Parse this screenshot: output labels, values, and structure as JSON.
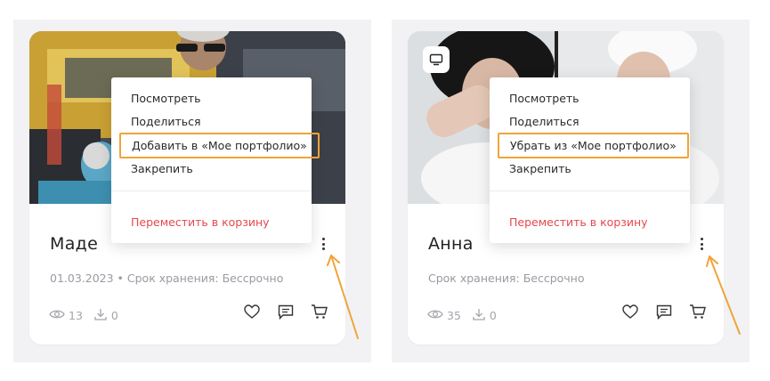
{
  "accent_color": "#f0a43a",
  "danger_color": "#e5484d",
  "cards": [
    {
      "title": "Маде",
      "meta": "01.03.2023 • Срок хранения: Бессрочно",
      "views": "13",
      "downloads": "0",
      "has_video_badge": false
    },
    {
      "title": "Анна",
      "meta": "Срок хранения: Бессрочно",
      "views": "35",
      "downloads": "0",
      "has_video_badge": true
    }
  ],
  "menus": [
    {
      "items": [
        "Посмотреть",
        "Поделиться",
        "Добавить в «Мое портфолио»",
        "Закрепить"
      ],
      "highlighted_index": 2,
      "danger_item": "Переместить в корзину"
    },
    {
      "items": [
        "Посмотреть",
        "Поделиться",
        "Убрать из «Мое портфолио»",
        "Закрепить"
      ],
      "highlighted_index": 2,
      "danger_item": "Переместить в корзину"
    }
  ],
  "icons": {
    "views": "eye-icon",
    "downloads": "download-icon",
    "like": "heart-icon",
    "comment": "comment-icon",
    "cart": "cart-icon",
    "video": "video-icon",
    "more": "more-vertical-icon"
  }
}
